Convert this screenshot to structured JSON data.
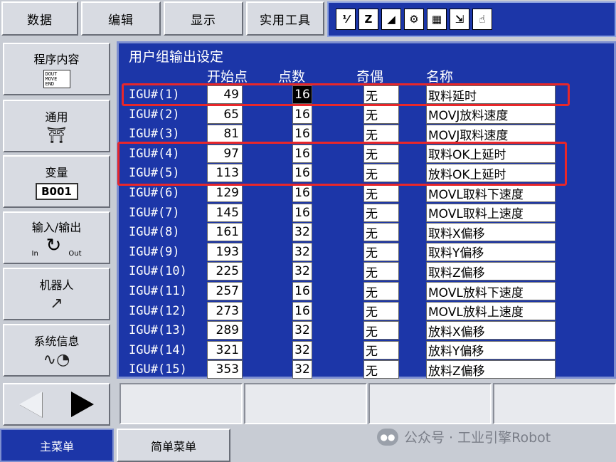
{
  "top_menu": [
    "数据",
    "编辑",
    "显示",
    "实用工具"
  ],
  "status_icons": [
    {
      "name": "cycle-1-2-icon",
      "glyph": "⅟"
    },
    {
      "name": "edit-mode-icon",
      "glyph": "Z"
    },
    {
      "name": "signal-icon",
      "glyph": "◢"
    },
    {
      "name": "gears-icon",
      "glyph": "⚙"
    },
    {
      "name": "memory-icon",
      "glyph": "▦"
    },
    {
      "name": "screen-arrow-icon",
      "glyph": "⇲"
    },
    {
      "name": "hand-icon",
      "glyph": "☝"
    }
  ],
  "left_menu": {
    "program": {
      "label": "程序内容",
      "icon_text": "DOUT\nMOVE\nEND"
    },
    "general": {
      "label": "通用"
    },
    "variable": {
      "label": "变量",
      "box": "B001"
    },
    "io": {
      "label": "输入/输出",
      "in": "In",
      "out": "Out"
    },
    "robot": {
      "label": "机器人"
    },
    "sysinfo": {
      "label": "系统信息"
    }
  },
  "panel": {
    "title": "用户组输出设定",
    "headers": {
      "start": "开始点",
      "points": "点数",
      "parity": "奇偶",
      "name": "名称"
    },
    "rows": [
      {
        "id": "IGU#(1)",
        "start": "49",
        "points": "16",
        "parity": "无",
        "name": "取料延时"
      },
      {
        "id": "IGU#(2)",
        "start": "65",
        "points": "16",
        "parity": "无",
        "name": "MOVJ放料速度"
      },
      {
        "id": "IGU#(3)",
        "start": "81",
        "points": "16",
        "parity": "无",
        "name": "MOVJ取料速度"
      },
      {
        "id": "IGU#(4)",
        "start": "97",
        "points": "16",
        "parity": "无",
        "name": "取料OK上延时"
      },
      {
        "id": "IGU#(5)",
        "start": "113",
        "points": "16",
        "parity": "无",
        "name": "放料OK上延时"
      },
      {
        "id": "IGU#(6)",
        "start": "129",
        "points": "16",
        "parity": "无",
        "name": "MOVL取料下速度"
      },
      {
        "id": "IGU#(7)",
        "start": "145",
        "points": "16",
        "parity": "无",
        "name": "MOVL取料上速度"
      },
      {
        "id": "IGU#(8)",
        "start": "161",
        "points": "32",
        "parity": "无",
        "name": "取料X偏移"
      },
      {
        "id": "IGU#(9)",
        "start": "193",
        "points": "32",
        "parity": "无",
        "name": "取料Y偏移"
      },
      {
        "id": "IGU#(10)",
        "start": "225",
        "points": "32",
        "parity": "无",
        "name": "取料Z偏移"
      },
      {
        "id": "IGU#(11)",
        "start": "257",
        "points": "16",
        "parity": "无",
        "name": "MOVL放料下速度"
      },
      {
        "id": "IGU#(12)",
        "start": "273",
        "points": "16",
        "parity": "无",
        "name": "MOVL放料上速度"
      },
      {
        "id": "IGU#(13)",
        "start": "289",
        "points": "32",
        "parity": "无",
        "name": "放料X偏移"
      },
      {
        "id": "IGU#(14)",
        "start": "321",
        "points": "32",
        "parity": "无",
        "name": "放料Y偏移"
      },
      {
        "id": "IGU#(15)",
        "start": "353",
        "points": "32",
        "parity": "无",
        "name": "放料Z偏移"
      }
    ]
  },
  "bottom_tabs": {
    "main": "主菜单",
    "simple": "简单菜单"
  },
  "watermark": "公众号 · 工业引擎Robot",
  "colors": {
    "panel_bg": "#1c36a8",
    "highlight": "#e8272a",
    "frame": "#c8ccd4"
  }
}
